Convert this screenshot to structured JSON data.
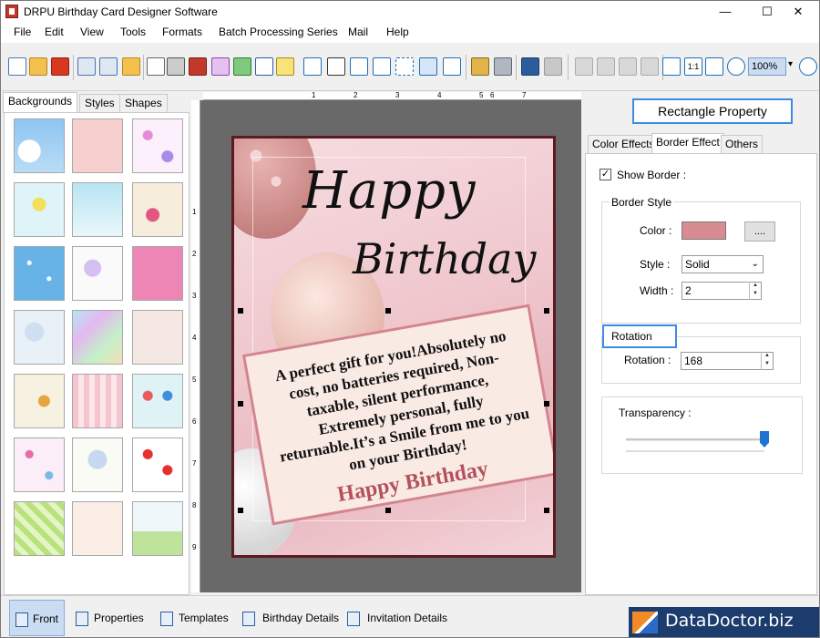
{
  "window": {
    "title": "DRPU Birthday Card Designer Software",
    "minimize": "—",
    "maximize": "☐",
    "close": "✕"
  },
  "menu": [
    "File",
    "Edit",
    "View",
    "Tools",
    "Formats",
    "Batch Processing Series",
    "Mail",
    "Help"
  ],
  "toolbar": {
    "zoom_value": "100%",
    "zoom_dropdown": "▾"
  },
  "left_panel": {
    "tabs": [
      "Backgrounds",
      "Styles",
      "Shapes"
    ],
    "active_tab": "Backgrounds"
  },
  "ruler": {
    "top_labels": [
      "1",
      "2",
      "3",
      "4",
      "5",
      "6",
      "7"
    ],
    "left_labels": [
      "1",
      "2",
      "3",
      "4",
      "5",
      "6",
      "7",
      "8",
      "9"
    ]
  },
  "card": {
    "title_line1": "Happy",
    "title_line2": "Birthday",
    "message": "A perfect gift for you!Absolutely no cost, no batteries required, Non-taxable, silent performance, Extremely personal, fully returnable.It’s a Smile from me to you on your Birthday!",
    "message_footer": "Happy Birthday",
    "message_border_color": "#d4848e",
    "card_border_color": "#5b1b22"
  },
  "right_panel": {
    "title": "Rectangle Property",
    "tabs": [
      "Color Effects",
      "Border Effect",
      "Others"
    ],
    "active_tab": "Border Effect",
    "show_border_label": "Show Border :",
    "show_border_checked": true,
    "border_style": {
      "group_label": "Border Style",
      "color_label": "Color :",
      "color_value": "#d98b93",
      "picker_button": "....",
      "style_label": "Style :",
      "style_value": "Solid",
      "width_label": "Width :",
      "width_value": "2"
    },
    "rotation": {
      "group_label": "Rotation",
      "label": "Rotation :",
      "value": "168"
    },
    "transparency": {
      "label": "Transparency :",
      "level": 1.0
    }
  },
  "bottom_tabs": [
    {
      "label": "Front",
      "active": true
    },
    {
      "label": "Properties",
      "active": false
    },
    {
      "label": "Templates",
      "active": false
    },
    {
      "label": "Birthday Details",
      "active": false
    },
    {
      "label": "Invitation Details",
      "active": false
    }
  ],
  "brand": "DataDoctor.biz"
}
